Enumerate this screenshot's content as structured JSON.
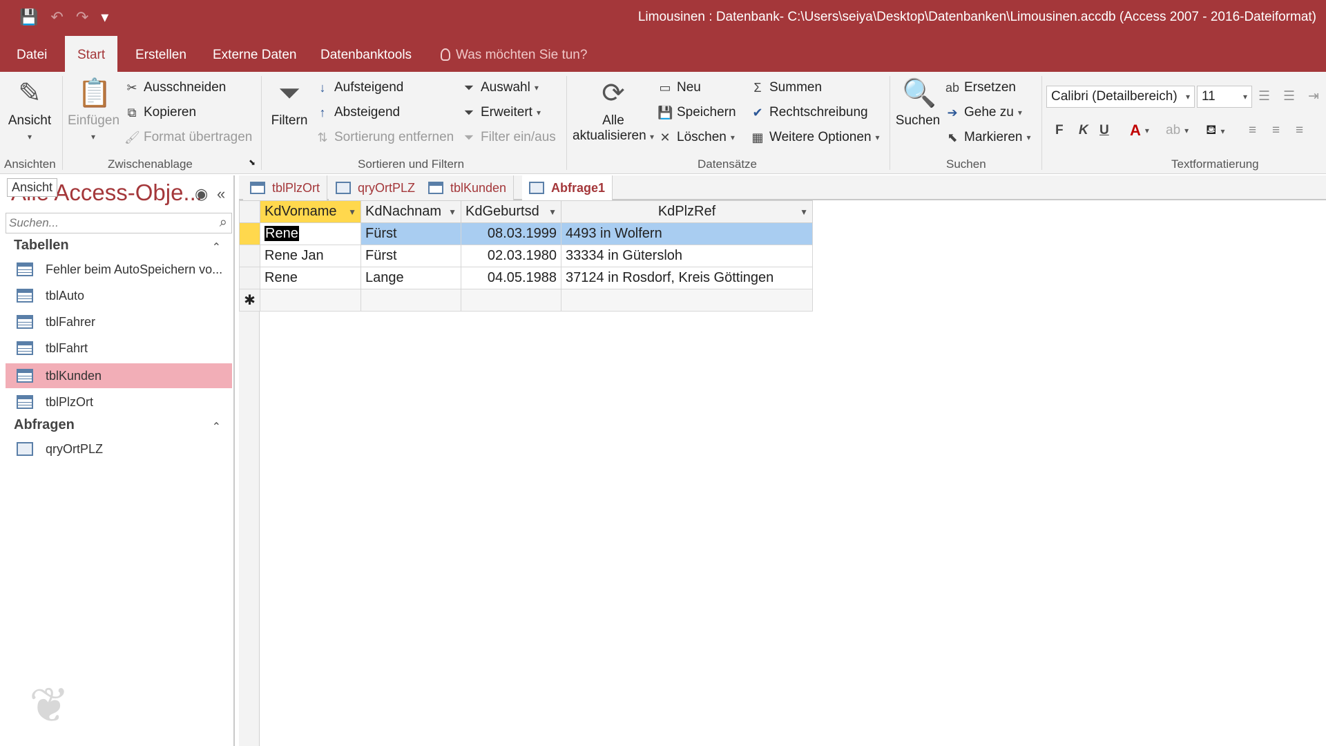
{
  "title": "Limousinen : Datenbank- C:\\Users\\seiya\\Desktop\\Datenbanken\\Limousinen.accdb (Access 2007 - 2016-Dateiformat)",
  "qat": {
    "save": "💾",
    "undo": "↶",
    "redo": "↷",
    "customize": "▾"
  },
  "tabs": [
    "Datei",
    "Start",
    "Erstellen",
    "Externe Daten",
    "Datenbanktools",
    "Was möchten Sie tun?"
  ],
  "ribbon": {
    "ansicht": "Ansicht",
    "einfuegen": "Einfügen",
    "ausschneiden": "Ausschneiden",
    "kopieren": "Kopieren",
    "format": "Format übertragen",
    "filtern": "Filtern",
    "aufsteigend": "Aufsteigend",
    "absteigend": "Absteigend",
    "sortierung": "Sortierung entfernen",
    "auswahl": "Auswahl",
    "erweitert": "Erweitert",
    "filtereinaus": "Filter ein/aus",
    "alle": "Alle",
    "aktualisieren": "aktualisieren",
    "neu": "Neu",
    "speichern": "Speichern",
    "loeschen": "Löschen",
    "summen": "Summen",
    "rechtschreibung": "Rechtschreibung",
    "weitere": "Weitere Optionen",
    "suchen": "Suchen",
    "ersetzen": "Ersetzen",
    "gehezu": "Gehe zu",
    "markieren": "Markieren",
    "font": "Calibri (Detailbereich)",
    "size": "11",
    "bold": "F",
    "italic": "K",
    "underline": "U",
    "groups": [
      "Ansichten",
      "Zwischenablage",
      "Sortieren und Filtern",
      "Datensätze",
      "Suchen",
      "Textformatierung"
    ]
  },
  "nav": {
    "tooltip": "Ansicht",
    "title": "Alle Access-Obje...",
    "search_placeholder": "Suchen...",
    "section_tables": "Tabellen",
    "tables": [
      "Fehler beim AutoSpeichern vo...",
      "tblAuto",
      "tblFahrer",
      "tblFahrt",
      "tblKunden",
      "tblPlzOrt"
    ],
    "section_queries": "Abfragen",
    "queries": [
      "qryOrtPLZ"
    ]
  },
  "doctabs": [
    "tblPlzOrt",
    "qryOrtPLZ",
    "tblKunden",
    "Abfrage1"
  ],
  "grid": {
    "columns": [
      "KdVorname",
      "KdNachnam",
      "KdGeburtsd",
      "KdPlzRef"
    ],
    "rows": [
      [
        "Rene",
        "Fürst",
        "08.03.1999",
        "4493 in Wolfern"
      ],
      [
        "Rene Jan",
        "Fürst",
        "02.03.1980",
        "33334 in Gütersloh"
      ],
      [
        "Rene",
        "Lange",
        "04.05.1988",
        "37124 in Rosdorf, Kreis Göttingen"
      ]
    ],
    "new_row_marker": "✱"
  }
}
